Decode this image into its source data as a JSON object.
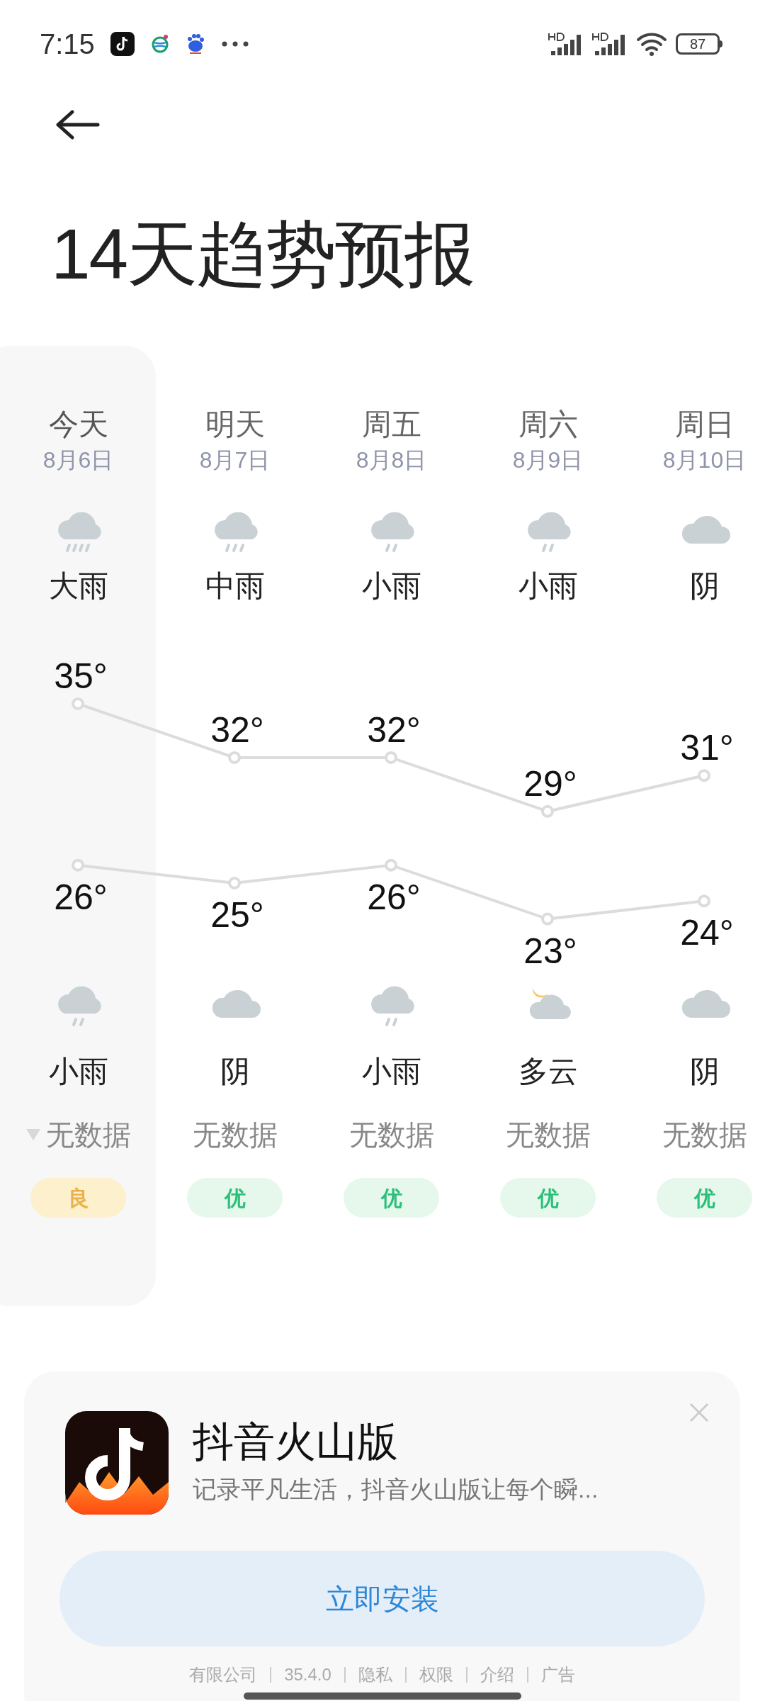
{
  "status_bar": {
    "time": "7:15",
    "battery": "87"
  },
  "title": "14天趋势预报",
  "days": [
    {
      "name": "今天",
      "date": "8月6日",
      "selected": true,
      "day": {
        "kind": "heavy_rain",
        "condition": "大雨"
      },
      "night": {
        "kind": "light_rain",
        "condition": "小雨"
      },
      "wind_arrow": true,
      "wind": "无数据",
      "aqi": {
        "label": "良",
        "kind": "good"
      }
    },
    {
      "name": "明天",
      "date": "8月7日",
      "selected": false,
      "day": {
        "kind": "moderate_rain",
        "condition": "中雨"
      },
      "night": {
        "kind": "overcast",
        "condition": "阴"
      },
      "wind_arrow": false,
      "wind": "无数据",
      "aqi": {
        "label": "优",
        "kind": "excellent"
      }
    },
    {
      "name": "周五",
      "date": "8月8日",
      "selected": false,
      "day": {
        "kind": "light_rain",
        "condition": "小雨"
      },
      "night": {
        "kind": "light_rain",
        "condition": "小雨"
      },
      "wind_arrow": false,
      "wind": "无数据",
      "aqi": {
        "label": "优",
        "kind": "excellent"
      }
    },
    {
      "name": "周六",
      "date": "8月9日",
      "selected": false,
      "day": {
        "kind": "light_rain",
        "condition": "小雨"
      },
      "night": {
        "kind": "partly_cloudy_night",
        "condition": "多云"
      },
      "wind_arrow": false,
      "wind": "无数据",
      "aqi": {
        "label": "优",
        "kind": "excellent"
      }
    },
    {
      "name": "周日",
      "date": "8月10日",
      "selected": false,
      "day": {
        "kind": "overcast",
        "condition": "阴"
      },
      "night": {
        "kind": "overcast",
        "condition": "阴"
      },
      "wind_arrow": false,
      "wind": "无数据",
      "aqi": {
        "label": "优",
        "kind": "excellent"
      }
    }
  ],
  "chart_data": {
    "type": "line",
    "series": [
      {
        "color": "#dcdcdc",
        "marker": "circle",
        "values": [
          35,
          32,
          32,
          29,
          31
        ],
        "value_labels": [
          "35°",
          "32°",
          "32°",
          "29°",
          "31°"
        ]
      },
      {
        "color": "#dcdcdc",
        "marker": "circle",
        "values": [
          26,
          25,
          26,
          23,
          24
        ],
        "value_labels": [
          "26°",
          "25°",
          "26°",
          "23°",
          "24°"
        ]
      }
    ]
  },
  "ad": {
    "app_name": "抖音火山版",
    "description": "记录平凡生活，抖音火山版让每个瞬...",
    "button": "立即安装",
    "footer": [
      "有限公司",
      "35.4.0",
      "隐私",
      "权限",
      "介绍",
      "广告"
    ]
  }
}
